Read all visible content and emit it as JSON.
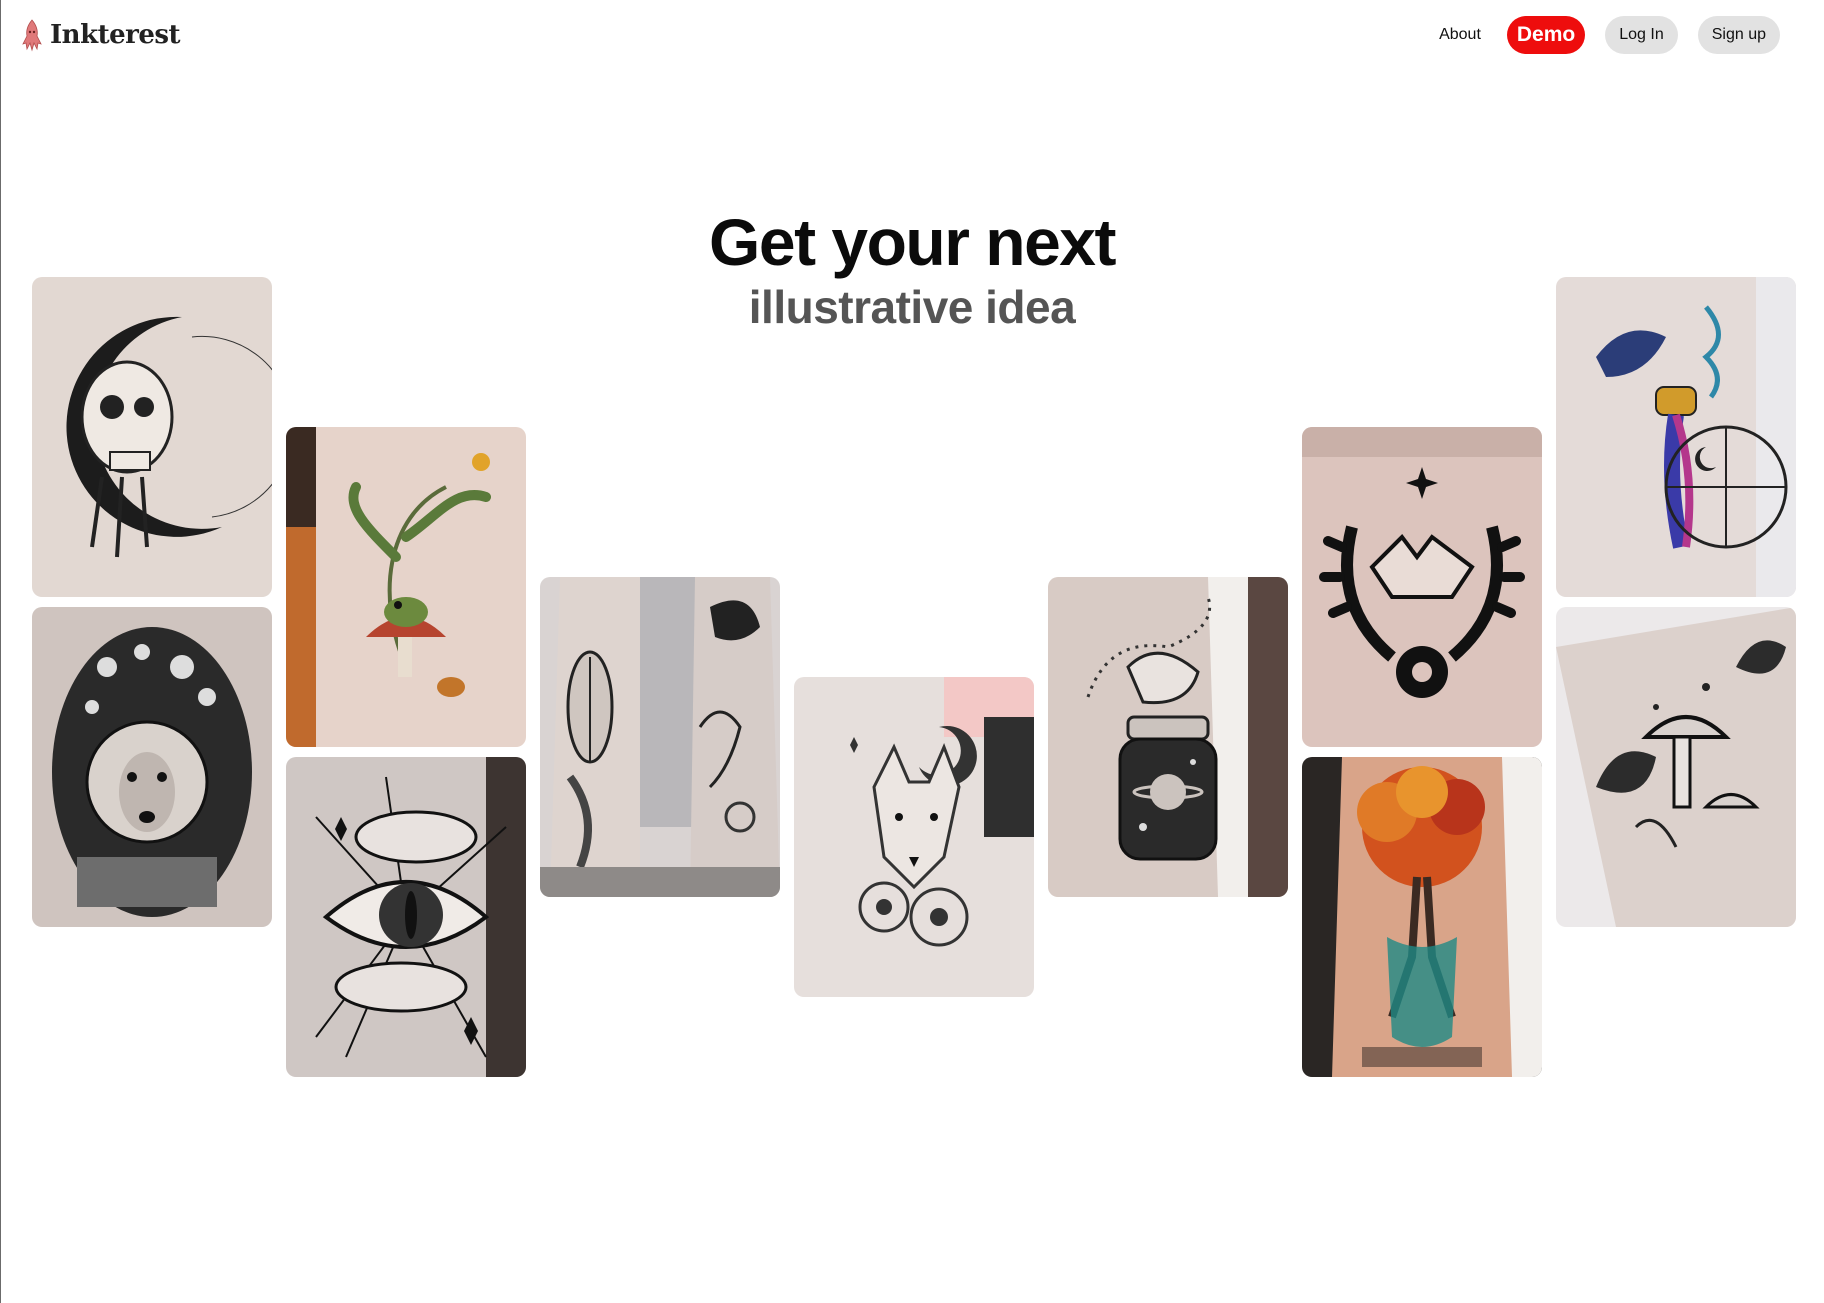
{
  "brand": {
    "name": "Inkterest",
    "icon": "squid-logo-icon",
    "icon_color": "#e0797a"
  },
  "nav": {
    "about_label": "About",
    "demo_label": "Demo",
    "login_label": "Log In",
    "signup_label": "Sign up",
    "demo_color": "#ee0d0d"
  },
  "hero": {
    "title": "Get your next",
    "subtitle": "illustrative idea"
  },
  "cards": [
    {
      "name": "skull-moon-tattoo"
    },
    {
      "name": "space-dog-tattoo"
    },
    {
      "name": "frog-mushroom-fern-tattoo"
    },
    {
      "name": "cloud-eye-tattoo"
    },
    {
      "name": "cicada-butterfly-tattoo"
    },
    {
      "name": "wolf-floral-tattoo"
    },
    {
      "name": "galaxy-jar-tattoo"
    },
    {
      "name": "skeleton-pinky-promise-tattoo"
    },
    {
      "name": "autumn-tree-tattoo"
    },
    {
      "name": "aquarius-woman-tattoo"
    },
    {
      "name": "mushroom-leaves-tattoo"
    }
  ]
}
